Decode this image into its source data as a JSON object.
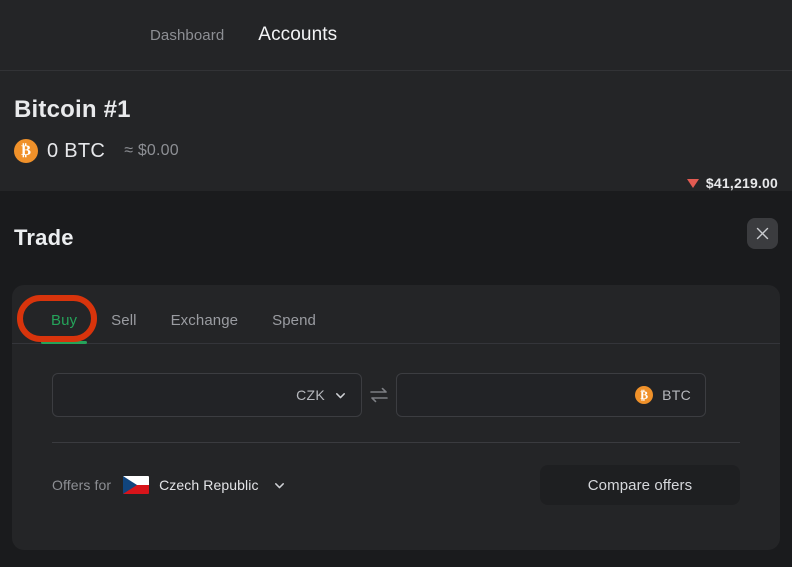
{
  "nav": {
    "items": [
      {
        "label": "Dashboard",
        "active": false
      },
      {
        "label": "Accounts",
        "active": true
      }
    ]
  },
  "account": {
    "title": "Bitcoin #1",
    "coin_icon": "bitcoin-icon",
    "coin_symbol": "₿",
    "balance": "0 BTC",
    "fiat_balance": "≈ $0.00",
    "price": "$41,219.00",
    "price_direction": "down",
    "price_arrow_color": "#e25b52"
  },
  "trade": {
    "title": "Trade",
    "close_label": "×",
    "tabs": [
      {
        "label": "Buy",
        "active": true
      },
      {
        "label": "Sell",
        "active": false
      },
      {
        "label": "Exchange",
        "active": false
      },
      {
        "label": "Spend",
        "active": false
      }
    ],
    "active_tab_color": "#25a35a",
    "annotation_color": "#d8340c",
    "fields": {
      "fiat": {
        "value": "",
        "placeholder": "",
        "currency": "CZK"
      },
      "crypto": {
        "value": "",
        "placeholder": "",
        "currency": "BTC",
        "icon": "bitcoin-icon",
        "symbol": "₿"
      },
      "swap_icon": "swap-arrows-icon"
    },
    "offers": {
      "label": "Offers for",
      "country": "Czech Republic",
      "flag": "czech-republic-flag",
      "compare_button": "Compare offers"
    }
  }
}
